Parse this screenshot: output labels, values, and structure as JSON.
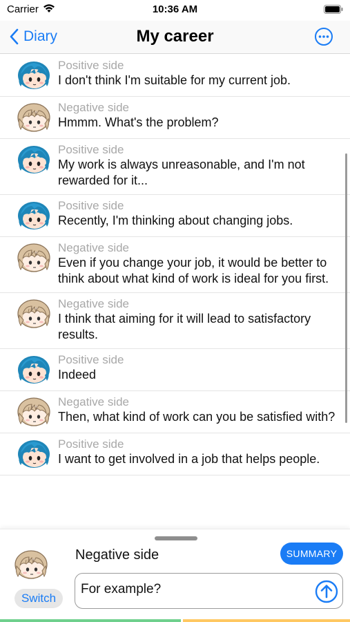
{
  "status_bar": {
    "carrier": "Carrier",
    "time": "10:36 AM"
  },
  "nav": {
    "back_label": "Diary",
    "title": "My career"
  },
  "messages": [
    {
      "speaker": "Positive side",
      "text": "I don't think I'm suitable for my current job.",
      "avatar": "blue-hair-avatar"
    },
    {
      "speaker": "Negative side",
      "text": "Hmmm. What's the problem?",
      "avatar": "tan-hair-avatar"
    },
    {
      "speaker": "Positive side",
      "text": "My work is always unreasonable, and I'm not rewarded for it...",
      "avatar": "blue-hair-avatar"
    },
    {
      "speaker": "Positive side",
      "text": "Recently, I'm thinking about changing jobs.",
      "avatar": "blue-hair-avatar"
    },
    {
      "speaker": "Negative side",
      "text": "Even if you change your job, it would be better to think about what kind of work is ideal for you first.",
      "avatar": "tan-hair-avatar"
    },
    {
      "speaker": "Negative side",
      "text": "I think that aiming for it will lead to satisfactory results.",
      "avatar": "tan-hair-avatar"
    },
    {
      "speaker": "Positive side",
      "text": "Indeed",
      "avatar": "blue-hair-avatar"
    },
    {
      "speaker": "Negative side",
      "text": "Then, what kind of work can you be satisfied with?",
      "avatar": "tan-hair-avatar"
    },
    {
      "speaker": "Positive side",
      "text": "I want to get involved in a job that helps people.",
      "avatar": "blue-hair-avatar"
    }
  ],
  "composer": {
    "role_label": "Negative side",
    "summary_label": "SUMMARY",
    "switch_label": "Switch",
    "input_value": "For example?"
  },
  "colors": {
    "accent": "#1a7cf5",
    "positive_hair": "#1f86b8",
    "negative_hair": "#d9c1a0",
    "bottom_bar_left": "#6fd08d",
    "bottom_bar_right": "#ffc862"
  }
}
